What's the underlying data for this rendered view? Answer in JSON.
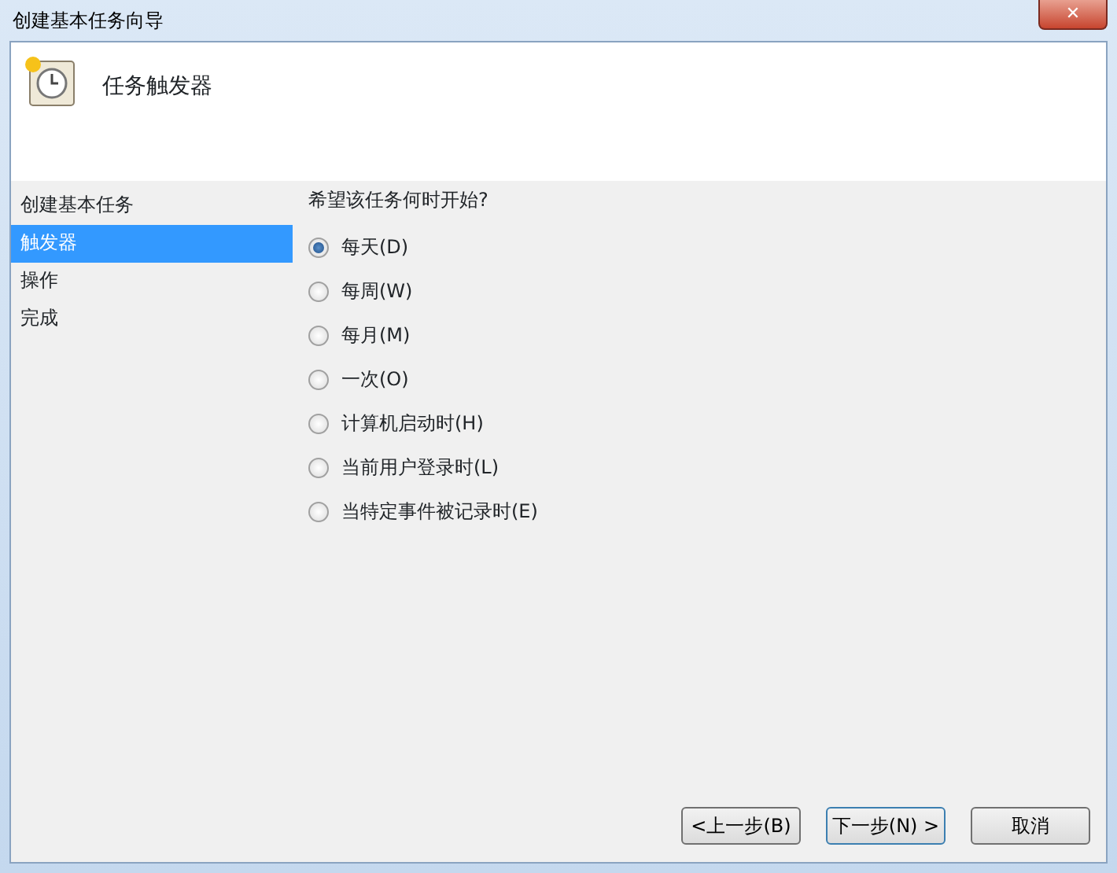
{
  "window": {
    "title": "创建基本任务向导",
    "close": "✕"
  },
  "header": {
    "title": "任务触发器"
  },
  "sidebar": {
    "items": [
      {
        "label": "创建基本任务",
        "selected": false
      },
      {
        "label": "触发器",
        "selected": true
      },
      {
        "label": "操作",
        "selected": false
      },
      {
        "label": "完成",
        "selected": false
      }
    ]
  },
  "question": "希望该任务何时开始?",
  "options": [
    {
      "label": "每天(D)",
      "selected": true
    },
    {
      "label": "每周(W)",
      "selected": false
    },
    {
      "label": "每月(M)",
      "selected": false
    },
    {
      "label": "一次(O)",
      "selected": false
    },
    {
      "label": "计算机启动时(H)",
      "selected": false
    },
    {
      "label": "当前用户登录时(L)",
      "selected": false
    },
    {
      "label": "当特定事件被记录时(E)",
      "selected": false
    }
  ],
  "buttons": [
    "<上一步(B)",
    "下一步(N) >",
    "取消"
  ]
}
